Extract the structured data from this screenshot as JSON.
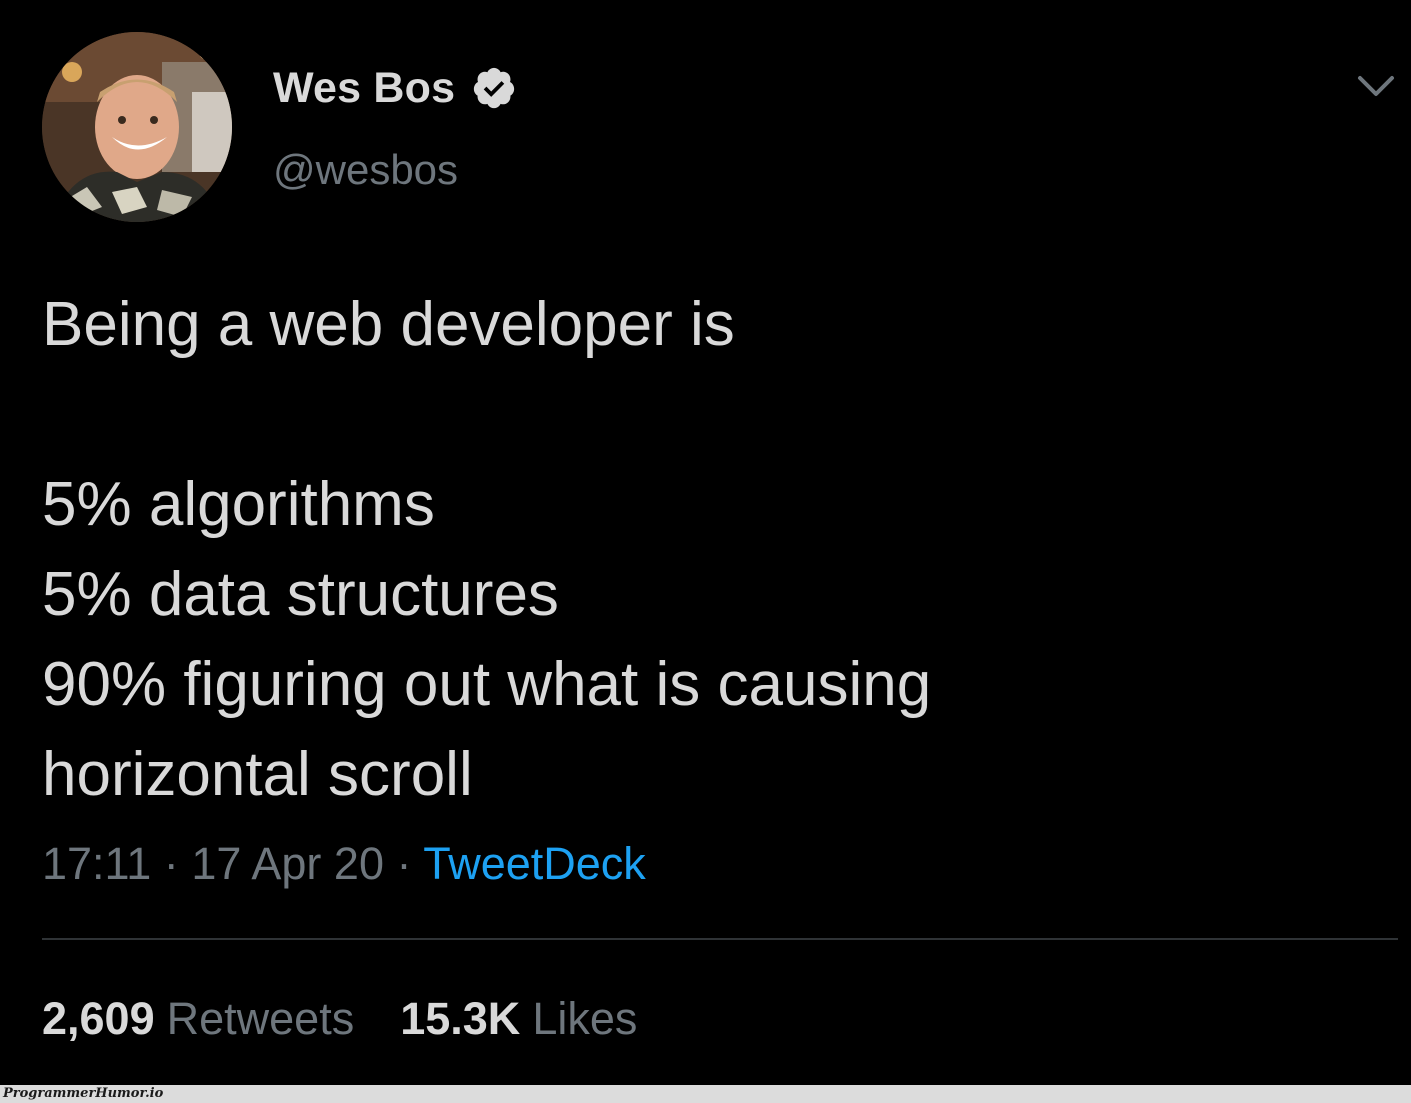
{
  "author": {
    "display_name": "Wes Bos",
    "handle": "@wesbos",
    "verified": true,
    "avatar_icon": "profile-photo"
  },
  "tweet": {
    "lines": [
      "Being a web developer is",
      "",
      "5% algorithms",
      "5% data structures",
      "90% figuring out what is causing",
      "horizontal scroll"
    ]
  },
  "meta": {
    "time": "17:11",
    "separator": "·",
    "date": "17 Apr 20",
    "source": "TweetDeck"
  },
  "stats": {
    "retweets_count": "2,609",
    "retweets_label": "Retweets",
    "likes_count": "15.3K",
    "likes_label": "Likes"
  },
  "watermark": {
    "text": "ProgrammerHumor.io"
  },
  "colors": {
    "background": "#000000",
    "text": "#d9d9d9",
    "muted": "#6e767d",
    "link": "#1da1f2",
    "divider": "#2f3336"
  }
}
